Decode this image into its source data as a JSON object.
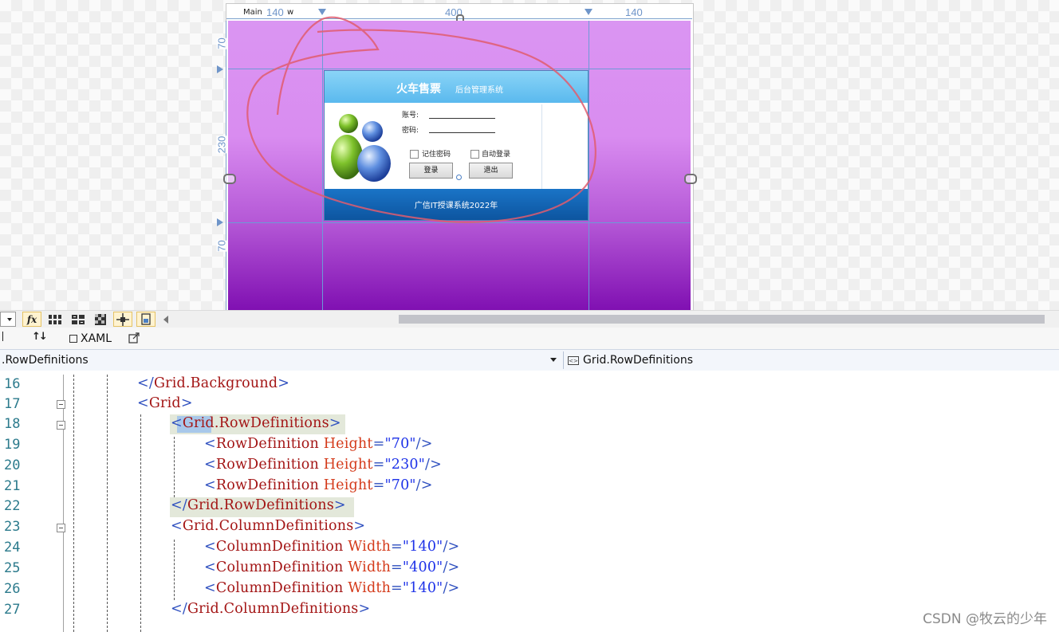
{
  "designer": {
    "window_title": "Main",
    "window_suffix": "w",
    "ruler_columns": [
      "140",
      "400",
      "140"
    ],
    "ruler_rows": [
      "70",
      "230",
      "70"
    ],
    "login_form": {
      "title": "火车售票",
      "subtitle": "后台管理系统",
      "account_label": "账号:",
      "password_label": "密码:",
      "remember_label": "记住密码",
      "autologin_label": "自动登录",
      "login_button": "登录",
      "exit_button": "退出",
      "footer": "广信IT授课系统2022年"
    },
    "colors": {
      "canvas_top": "#da95f2",
      "canvas_bottom": "#8010b2",
      "header": "#5ab9ee",
      "footer": "#0d55a0",
      "annotation": "#e05c6e"
    }
  },
  "toolbar": {
    "icons": [
      "dropdown-arrow",
      "fx-icon",
      "grid-icon",
      "split-grid-icon",
      "checker-icon",
      "snap-icon",
      "snapline-icon",
      "scroll-left-icon"
    ]
  },
  "tabs": {
    "sort_icon_label": "↑↓",
    "xaml_label": "XAML"
  },
  "nav": {
    "left": ".RowDefinitions",
    "right": "Grid.RowDefinitions"
  },
  "code": {
    "lines": [
      {
        "num": "16",
        "parts": [
          [
            "b",
            "</"
          ],
          [
            "r",
            "Grid.Background"
          ],
          [
            "b",
            ">"
          ]
        ]
      },
      {
        "num": "17",
        "parts": [
          [
            "b",
            "<"
          ],
          [
            "r",
            "Grid"
          ],
          [
            "b",
            ">"
          ]
        ]
      },
      {
        "num": "18",
        "parts": [
          [
            "b",
            "<"
          ],
          [
            "r",
            "Grid.RowDefinitions"
          ],
          [
            "b",
            ">"
          ]
        ]
      },
      {
        "num": "19",
        "parts": [
          [
            "b",
            "<"
          ],
          [
            "r",
            "RowDefinition"
          ],
          [
            "attr",
            " Height"
          ],
          [
            "b",
            "="
          ],
          [
            "v",
            "\"70\""
          ],
          [
            "b",
            "/>"
          ]
        ]
      },
      {
        "num": "20",
        "parts": [
          [
            "b",
            "<"
          ],
          [
            "r",
            "RowDefinition"
          ],
          [
            "attr",
            " Height"
          ],
          [
            "b",
            "="
          ],
          [
            "v",
            "\"230\""
          ],
          [
            "b",
            "/>"
          ]
        ]
      },
      {
        "num": "21",
        "parts": [
          [
            "b",
            "<"
          ],
          [
            "r",
            "RowDefinition"
          ],
          [
            "attr",
            " Height"
          ],
          [
            "b",
            "="
          ],
          [
            "v",
            "\"70\""
          ],
          [
            "b",
            "/>"
          ]
        ]
      },
      {
        "num": "22",
        "parts": [
          [
            "b",
            "</"
          ],
          [
            "r",
            "Grid.RowDefinitions"
          ],
          [
            "b",
            ">"
          ]
        ]
      },
      {
        "num": "23",
        "parts": [
          [
            "b",
            "<"
          ],
          [
            "r",
            "Grid.ColumnDefinitions"
          ],
          [
            "b",
            ">"
          ]
        ]
      },
      {
        "num": "24",
        "parts": [
          [
            "b",
            "<"
          ],
          [
            "r",
            "ColumnDefinition"
          ],
          [
            "attr",
            " Width"
          ],
          [
            "b",
            "="
          ],
          [
            "v",
            "\"140\""
          ],
          [
            "b",
            "/>"
          ]
        ]
      },
      {
        "num": "25",
        "parts": [
          [
            "b",
            "<"
          ],
          [
            "r",
            "ColumnDefinition"
          ],
          [
            "attr",
            " Width"
          ],
          [
            "b",
            "="
          ],
          [
            "v",
            "\"400\""
          ],
          [
            "b",
            "/>"
          ]
        ]
      },
      {
        "num": "26",
        "parts": [
          [
            "b",
            "<"
          ],
          [
            "r",
            "ColumnDefinition"
          ],
          [
            "attr",
            " Width"
          ],
          [
            "b",
            "="
          ],
          [
            "v",
            "\"140\""
          ],
          [
            "b",
            "/>"
          ]
        ]
      },
      {
        "num": "27",
        "parts": [
          [
            "b",
            "</"
          ],
          [
            "r",
            "Grid.ColumnDefinitions"
          ],
          [
            "b",
            ">"
          ]
        ]
      }
    ]
  },
  "watermark": "CSDN @牧云的少年"
}
